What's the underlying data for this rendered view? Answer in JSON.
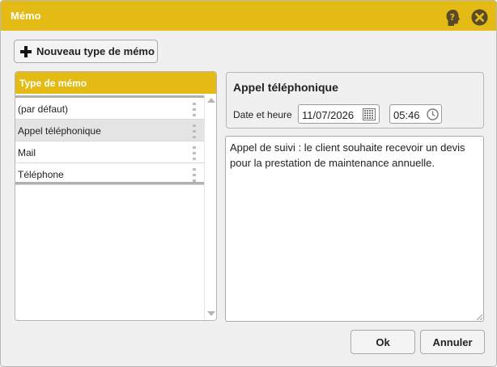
{
  "window": {
    "title": "Mémo"
  },
  "toolbar": {
    "new_type_label": "Nouveau type de mémo"
  },
  "memo_types": {
    "header": "Type de mémo",
    "items": [
      {
        "label": "(par défaut)",
        "selected": false
      },
      {
        "label": "Appel téléphonique",
        "selected": true
      },
      {
        "label": "Mail",
        "selected": false
      },
      {
        "label": "Téléphone",
        "selected": false
      }
    ]
  },
  "detail": {
    "title": "Appel téléphonique",
    "datetime_label": "Date et heure",
    "date_value": "11/07/2026",
    "time_value": "05:46",
    "memo_text": "Appel de suivi : le client souhaite recevoir un devis pour la prestation de maintenance annuelle."
  },
  "footer": {
    "ok_label": "Ok",
    "cancel_label": "Annuler"
  },
  "colors": {
    "accent": "#e3bb14",
    "icon_dark": "#5a4a2a"
  },
  "icons": {
    "help": "help-head-icon",
    "close": "close-circle-icon",
    "add": "plus-icon"
  }
}
